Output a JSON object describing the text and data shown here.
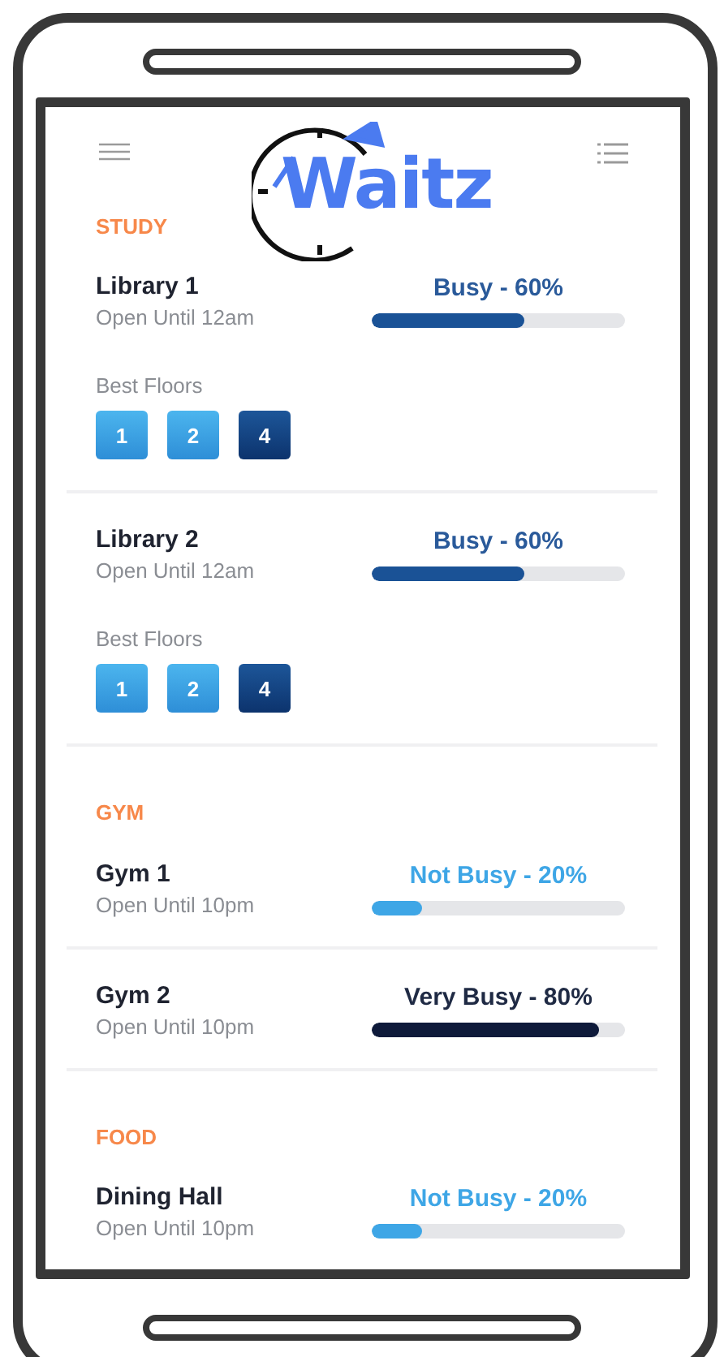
{
  "logo": {
    "text": "Waitz"
  },
  "sections": [
    {
      "title": "STUDY",
      "places": [
        {
          "name": "Library 1",
          "hours": "Open Until 12am",
          "status": "Busy - 60%",
          "kind": "busy",
          "level": 0.6,
          "floors_label": "Best Floors",
          "floors": [
            {
              "label": "1",
              "selected": false
            },
            {
              "label": "2",
              "selected": false
            },
            {
              "label": "4",
              "selected": true
            }
          ]
        },
        {
          "name": "Library 2",
          "hours": "Open Until 12am",
          "status": "Busy - 60%",
          "kind": "busy",
          "level": 0.6,
          "floors_label": "Best Floors",
          "floors": [
            {
              "label": "1",
              "selected": false
            },
            {
              "label": "2",
              "selected": false
            },
            {
              "label": "4",
              "selected": true
            }
          ]
        }
      ]
    },
    {
      "title": "GYM",
      "places": [
        {
          "name": "Gym 1",
          "hours": "Open Until 10pm",
          "status": "Not Busy - 20%",
          "kind": "not_busy",
          "level": 0.2
        },
        {
          "name": "Gym 2",
          "hours": "Open Until 10pm",
          "status": "Very Busy - 80%",
          "kind": "very_busy",
          "level": 0.9
        }
      ]
    },
    {
      "title": "FOOD",
      "places": [
        {
          "name": "Dining Hall",
          "hours": "Open Until 10pm",
          "status": "Not Busy - 20%",
          "kind": "not_busy",
          "level": 0.2
        }
      ]
    }
  ]
}
